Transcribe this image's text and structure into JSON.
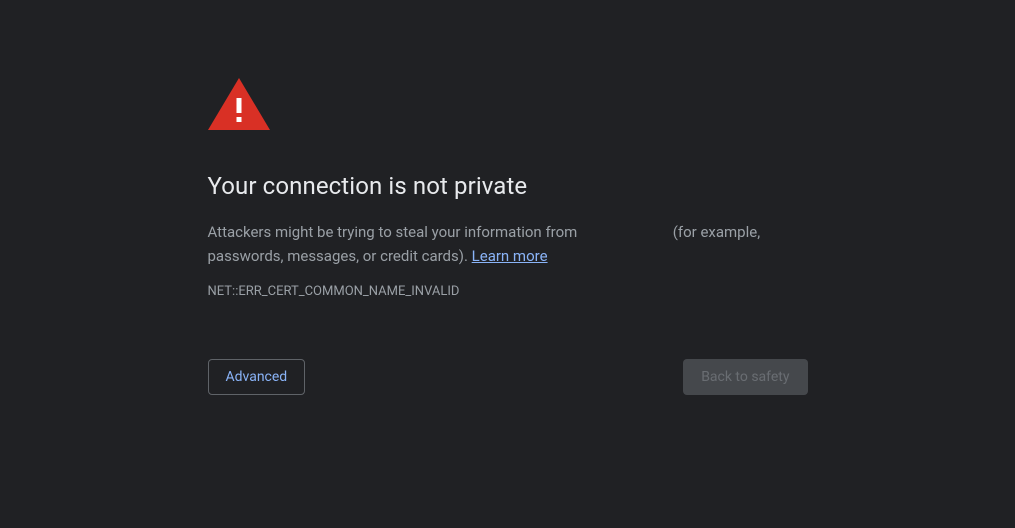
{
  "title": "Your connection is not private",
  "description_prefix": "Attackers might be trying to steal your information from ",
  "description_suffix": " (for example, passwords, messages, or credit cards). ",
  "learn_more_label": "Learn more",
  "error_code": "NET::ERR_CERT_COMMON_NAME_INVALID",
  "buttons": {
    "advanced": "Advanced",
    "back_to_safety": "Back to safety"
  },
  "colors": {
    "background": "#202124",
    "text_primary": "#e8eaed",
    "text_secondary": "#9aa0a6",
    "link": "#8ab4f8",
    "warning_triangle": "#d93025"
  }
}
